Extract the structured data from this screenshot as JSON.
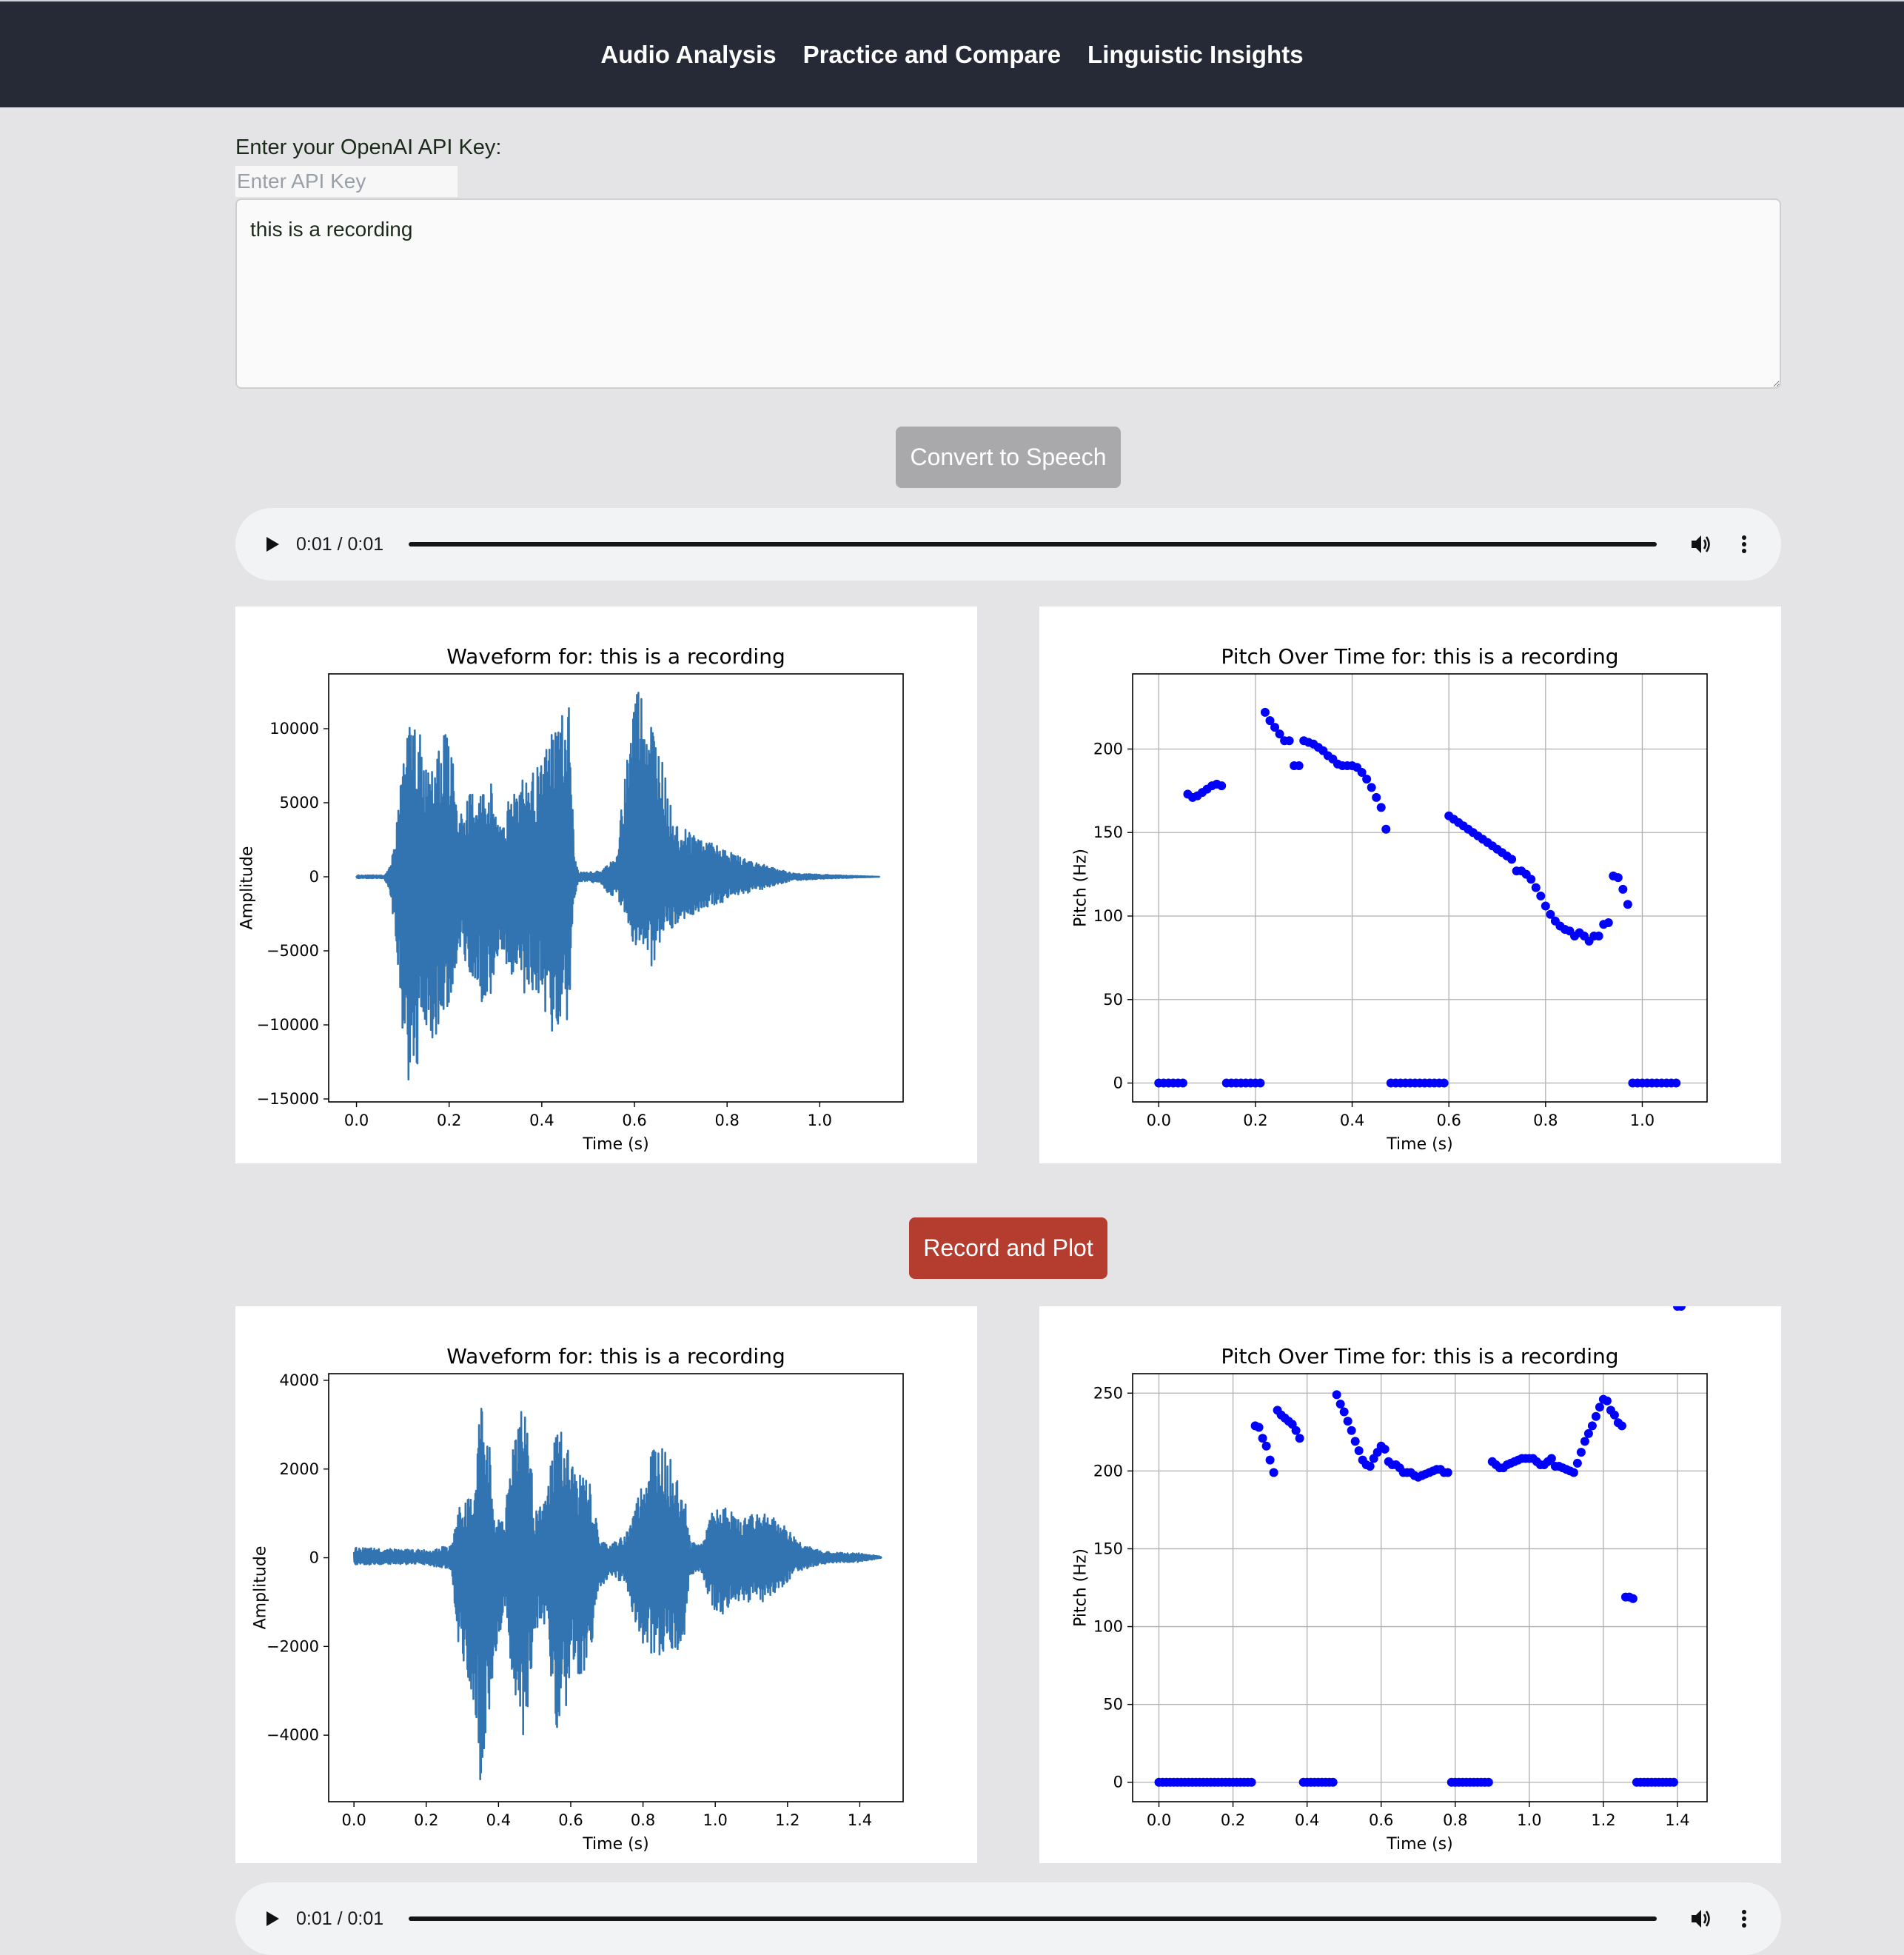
{
  "nav": {
    "items": [
      "Audio Analysis",
      "Practice and Compare",
      "Linguistic Insights"
    ]
  },
  "form": {
    "api_label": "Enter your OpenAI API Key:",
    "api_placeholder": "Enter API Key",
    "text_value": "this is a recording",
    "convert_button": "Convert to Speech",
    "record_button": "Record and Plot"
  },
  "audio": {
    "top": {
      "time": "0:01 / 0:01"
    },
    "bottom": {
      "time": "0:01 / 0:01"
    }
  },
  "colors": {
    "nav_bg": "#262a36",
    "waveform": "#3274b2",
    "pitch_points": "#0000ff",
    "record_button": "#b43d2f",
    "convert_button": "#a9a9ab"
  },
  "chart_data": [
    {
      "id": "tts-waveform",
      "type": "line",
      "title": "Waveform for: this is a recording",
      "xlabel": "Time (s)",
      "ylabel": "Amplitude",
      "xlim": [
        -0.06,
        1.18
      ],
      "ylim": [
        -15200,
        13700
      ],
      "xticks": [
        0.0,
        0.2,
        0.4,
        0.6,
        0.8,
        1.0
      ],
      "xtick_labels": [
        "0.0",
        "0.2",
        "0.4",
        "0.6",
        "0.8",
        "1.0"
      ],
      "yticks": [
        10000,
        5000,
        0,
        -5000,
        -10000,
        -15000
      ],
      "ytick_labels": [
        "10000",
        "5000",
        "0",
        "−5000",
        "−10000",
        "−15000"
      ],
      "grid": false,
      "envelope": {
        "x": [
          0.0,
          0.06,
          0.075,
          0.085,
          0.1,
          0.11,
          0.13,
          0.15,
          0.16,
          0.19,
          0.2,
          0.22,
          0.23,
          0.25,
          0.27,
          0.29,
          0.31,
          0.34,
          0.36,
          0.37,
          0.4,
          0.42,
          0.44,
          0.46,
          0.47,
          0.48,
          0.5,
          0.53,
          0.55,
          0.56,
          0.6,
          0.62,
          0.64,
          0.66,
          0.68,
          0.7,
          0.74,
          0.77,
          0.8,
          0.83,
          0.87,
          0.9,
          0.94,
          1.0,
          1.06,
          1.13
        ],
        "upper": [
          100,
          100,
          900,
          3000,
          8500,
          10300,
          11000,
          7500,
          10000,
          9600,
          10600,
          3800,
          5000,
          5800,
          5900,
          6500,
          3700,
          6400,
          7000,
          6800,
          7600,
          10000,
          11000,
          11700,
          1400,
          300,
          300,
          400,
          1200,
          900,
          13500,
          12500,
          10500,
          7800,
          4500,
          3500,
          2800,
          2200,
          1800,
          1300,
          1000,
          600,
          250,
          150,
          80,
          0
        ],
        "lower": [
          -100,
          -100,
          -1500,
          -5000,
          -11000,
          -14000,
          -14400,
          -10000,
          -11500,
          -9800,
          -10500,
          -4500,
          -5200,
          -7200,
          -8500,
          -8000,
          -4500,
          -7500,
          -7800,
          -8000,
          -8300,
          -11000,
          -10000,
          -9500,
          -1800,
          -300,
          -300,
          -500,
          -1500,
          -1000,
          -4700,
          -4500,
          -6500,
          -3600,
          -3500,
          -3000,
          -2500,
          -2000,
          -1600,
          -1200,
          -900,
          -600,
          -250,
          -150,
          -80,
          0
        ]
      }
    },
    {
      "id": "tts-pitch",
      "type": "scatter",
      "title": "Pitch Over Time for: this is a recording",
      "xlabel": "Time (s)",
      "ylabel": "Pitch (Hz)",
      "xlim": [
        -0.054,
        1.134
      ],
      "ylim": [
        -11.3,
        245
      ],
      "xticks": [
        0.0,
        0.2,
        0.4,
        0.6,
        0.8,
        1.0
      ],
      "xtick_labels": [
        "0.0",
        "0.2",
        "0.4",
        "0.6",
        "0.8",
        "1.0"
      ],
      "yticks": [
        0,
        50,
        100,
        150,
        200
      ],
      "ytick_labels": [
        "0",
        "50",
        "100",
        "150",
        "200"
      ],
      "grid": true,
      "x": [
        0.0,
        0.01,
        0.02,
        0.03,
        0.04,
        0.05,
        0.06,
        0.07,
        0.08,
        0.09,
        0.1,
        0.11,
        0.12,
        0.13,
        0.14,
        0.15,
        0.16,
        0.17,
        0.18,
        0.19,
        0.2,
        0.21,
        0.22,
        0.23,
        0.24,
        0.25,
        0.26,
        0.27,
        0.28,
        0.29,
        0.3,
        0.31,
        0.32,
        0.33,
        0.34,
        0.35,
        0.36,
        0.37,
        0.38,
        0.39,
        0.4,
        0.41,
        0.42,
        0.43,
        0.44,
        0.45,
        0.46,
        0.47,
        0.48,
        0.49,
        0.5,
        0.51,
        0.52,
        0.53,
        0.54,
        0.55,
        0.56,
        0.57,
        0.58,
        0.59,
        0.6,
        0.61,
        0.62,
        0.63,
        0.64,
        0.65,
        0.66,
        0.67,
        0.68,
        0.69,
        0.7,
        0.71,
        0.72,
        0.73,
        0.74,
        0.75,
        0.76,
        0.77,
        0.78,
        0.79,
        0.8,
        0.81,
        0.82,
        0.83,
        0.84,
        0.85,
        0.86,
        0.87,
        0.88,
        0.89,
        0.9,
        0.91,
        0.92,
        0.93,
        0.94,
        0.95,
        0.96,
        0.97,
        0.98,
        0.99,
        1.0,
        1.01,
        1.02,
        1.03,
        1.04,
        1.05,
        1.06,
        1.07
      ],
      "y": [
        0,
        0,
        0,
        0,
        0,
        0,
        173,
        171,
        172,
        174,
        176,
        178,
        179,
        178,
        0,
        0,
        0,
        0,
        0,
        0,
        0,
        0,
        222,
        217,
        213,
        209,
        205,
        205,
        190,
        190,
        205,
        204,
        203,
        201,
        199,
        196,
        194,
        191,
        190,
        190,
        190,
        189,
        186,
        182,
        177,
        171,
        165,
        152,
        0,
        0,
        0,
        0,
        0,
        0,
        0,
        0,
        0,
        0,
        0,
        0,
        160,
        158,
        156,
        154,
        152,
        150,
        148,
        146,
        144,
        142,
        140,
        138,
        136,
        134,
        127,
        127,
        125,
        122,
        117,
        112,
        106,
        101,
        97,
        94,
        92,
        91,
        88,
        90,
        88,
        85,
        88,
        88,
        95,
        96,
        124,
        123,
        116,
        107,
        0,
        0,
        0,
        0,
        0,
        0,
        0,
        0,
        0,
        0
      ]
    },
    {
      "id": "rec-waveform",
      "type": "line",
      "title": "Waveform for: this is a recording",
      "xlabel": "Time (s)",
      "ylabel": "Amplitude",
      "xlim": [
        -0.07,
        1.52
      ],
      "ylim": [
        -5500,
        4150
      ],
      "xticks": [
        0.0,
        0.2,
        0.4,
        0.6,
        0.8,
        1.0,
        1.2,
        1.4
      ],
      "xtick_labels": [
        "0.0",
        "0.2",
        "0.4",
        "0.6",
        "0.8",
        "1.0",
        "1.2",
        "1.4"
      ],
      "yticks": [
        4000,
        2000,
        0,
        -2000,
        -4000
      ],
      "ytick_labels": [
        "4000",
        "2000",
        "0",
        "−2000",
        "−4000"
      ],
      "grid": false,
      "envelope": {
        "x": [
          0.0,
          0.1,
          0.2,
          0.27,
          0.29,
          0.31,
          0.33,
          0.35,
          0.37,
          0.39,
          0.42,
          0.45,
          0.48,
          0.5,
          0.53,
          0.56,
          0.58,
          0.61,
          0.65,
          0.68,
          0.71,
          0.75,
          0.79,
          0.83,
          0.87,
          0.91,
          0.93,
          0.96,
          0.99,
          1.03,
          1.07,
          1.1,
          1.13,
          1.18,
          1.23,
          1.27,
          1.32,
          1.4,
          1.46
        ],
        "upper": [
          230,
          200,
          180,
          280,
          1200,
          1300,
          1400,
          3700,
          3200,
          800,
          1200,
          3600,
          3400,
          1000,
          1300,
          3100,
          2800,
          2000,
          1800,
          400,
          300,
          500,
          1500,
          2700,
          2300,
          1800,
          400,
          300,
          1000,
          1200,
          800,
          1100,
          1100,
          800,
          400,
          200,
          120,
          100,
          30
        ],
        "lower": [
          -170,
          -150,
          -150,
          -300,
          -2000,
          -2500,
          -3500,
          -5100,
          -3800,
          -2300,
          -1000,
          -4300,
          -3800,
          -1700,
          -1500,
          -4000,
          -3500,
          -2800,
          -2400,
          -700,
          -400,
          -600,
          -1800,
          -2300,
          -2000,
          -2200,
          -400,
          -300,
          -1200,
          -1300,
          -1000,
          -1000,
          -1000,
          -700,
          -300,
          -200,
          -120,
          -100,
          0
        ]
      }
    },
    {
      "id": "rec-pitch",
      "type": "scatter",
      "title": "Pitch Over Time for: this is a recording",
      "xlabel": "Time (s)",
      "ylabel": "Pitch (Hz)",
      "xlim": [
        -0.071,
        1.48
      ],
      "ylim": [
        -12.5,
        262.5
      ],
      "xticks": [
        0.0,
        0.2,
        0.4,
        0.6,
        0.8,
        1.0,
        1.2,
        1.4
      ],
      "xtick_labels": [
        "0.0",
        "0.2",
        "0.4",
        "0.6",
        "0.8",
        "1.0",
        "1.2",
        "1.4"
      ],
      "yticks": [
        0,
        50,
        100,
        150,
        200,
        250
      ],
      "ytick_labels": [
        "0",
        "50",
        "100",
        "150",
        "200",
        "250"
      ],
      "grid": true,
      "x": [
        0.0,
        0.01,
        0.02,
        0.03,
        0.04,
        0.05,
        0.06,
        0.07,
        0.08,
        0.09,
        0.1,
        0.11,
        0.12,
        0.13,
        0.14,
        0.15,
        0.16,
        0.17,
        0.18,
        0.19,
        0.2,
        0.21,
        0.22,
        0.23,
        0.24,
        0.25,
        0.26,
        0.27,
        0.28,
        0.29,
        0.3,
        0.31,
        0.32,
        0.33,
        0.34,
        0.35,
        0.36,
        0.37,
        0.38,
        0.39,
        0.4,
        0.41,
        0.42,
        0.43,
        0.44,
        0.45,
        0.46,
        0.47,
        0.48,
        0.49,
        0.5,
        0.51,
        0.52,
        0.53,
        0.54,
        0.55,
        0.56,
        0.57,
        0.58,
        0.59,
        0.6,
        0.61,
        0.62,
        0.63,
        0.64,
        0.65,
        0.66,
        0.67,
        0.68,
        0.69,
        0.7,
        0.71,
        0.72,
        0.73,
        0.74,
        0.75,
        0.76,
        0.77,
        0.78,
        0.79,
        0.8,
        0.81,
        0.82,
        0.83,
        0.84,
        0.85,
        0.86,
        0.87,
        0.88,
        0.89,
        0.9,
        0.91,
        0.92,
        0.93,
        0.94,
        0.95,
        0.96,
        0.97,
        0.98,
        0.99,
        1.0,
        1.01,
        1.02,
        1.03,
        1.04,
        1.05,
        1.06,
        1.07,
        1.08,
        1.09,
        1.1,
        1.11,
        1.12,
        1.13,
        1.14,
        1.15,
        1.16,
        1.17,
        1.18,
        1.19,
        1.2,
        1.21,
        1.22,
        1.23,
        1.24,
        1.25,
        1.26,
        1.27,
        1.28,
        1.29,
        1.3,
        1.31,
        1.32,
        1.33,
        1.34,
        1.35,
        1.36,
        1.37,
        1.38,
        1.39,
        1.4,
        1.41
      ],
      "y": [
        0,
        0,
        0,
        0,
        0,
        0,
        0,
        0,
        0,
        0,
        0,
        0,
        0,
        0,
        0,
        0,
        0,
        0,
        0,
        0,
        0,
        0,
        0,
        0,
        0,
        0,
        229,
        228,
        221,
        216,
        207,
        199,
        239,
        236,
        234,
        232,
        230,
        226,
        221,
        0,
        0,
        0,
        0,
        0,
        0,
        0,
        0,
        0,
        249,
        243,
        238,
        232,
        226,
        219,
        213,
        207,
        204,
        203,
        208,
        212,
        216,
        214,
        206,
        204,
        204,
        202,
        199,
        199,
        199,
        197,
        196,
        197,
        198,
        199,
        200,
        201,
        201,
        199,
        199,
        0,
        0,
        0,
        0,
        0,
        0,
        0,
        0,
        0,
        0,
        0,
        206,
        204,
        202,
        202,
        204,
        205,
        206,
        207,
        208,
        208,
        208,
        208,
        206,
        204,
        204,
        206,
        208,
        203,
        203,
        202,
        201,
        200,
        199,
        205,
        212,
        219,
        224,
        229,
        235,
        241,
        246,
        245,
        239,
        236,
        231,
        229,
        119,
        119,
        118,
        0,
        0,
        0,
        0,
        0,
        0,
        0,
        0,
        0,
        0,
        0
      ]
    }
  ]
}
